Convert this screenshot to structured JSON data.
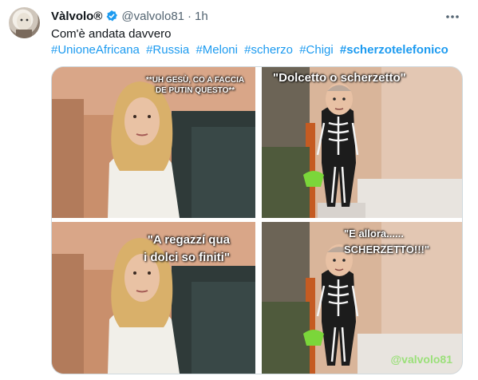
{
  "tweet": {
    "display_name": "Vàlvolo®",
    "handle": "@valvolo81",
    "separator": "·",
    "time": "1h",
    "text": "Com'è andata davvero",
    "hashtags": [
      "#UnioneAfricana",
      "#Russia",
      "#Meloni",
      "#scherzo",
      "#Chigi"
    ],
    "hashtag_bold": "#scherzotelefonico"
  },
  "media": {
    "caption_1": "**UH GESÙ, CO A FACCIA DE PUTIN QUESTO**",
    "caption_2": "\"Dolcetto o scherzetto\"",
    "caption_3_line1": "\"A regazzí qua",
    "caption_3_line2": "i dolci so finiti\"",
    "caption_4_line1": "\"E allora......",
    "caption_4_line2": "SCHERZETTO!!!\"",
    "watermark": "@valvolo81"
  },
  "colors": {
    "link": "#1d9bf0",
    "verified": "#1d9bf0",
    "secondary": "#536471"
  }
}
